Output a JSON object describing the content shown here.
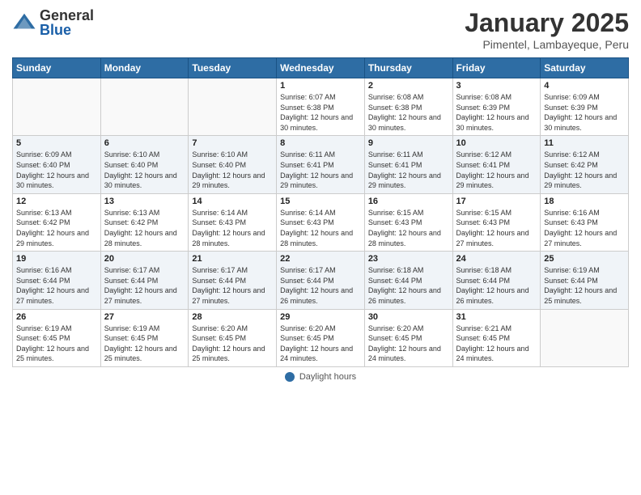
{
  "header": {
    "logo_general": "General",
    "logo_blue": "Blue",
    "title": "January 2025",
    "subtitle": "Pimentel, Lambayeque, Peru"
  },
  "days_of_week": [
    "Sunday",
    "Monday",
    "Tuesday",
    "Wednesday",
    "Thursday",
    "Friday",
    "Saturday"
  ],
  "weeks": [
    [
      {
        "day": "",
        "info": ""
      },
      {
        "day": "",
        "info": ""
      },
      {
        "day": "",
        "info": ""
      },
      {
        "day": "1",
        "info": "Sunrise: 6:07 AM\nSunset: 6:38 PM\nDaylight: 12 hours and 30 minutes."
      },
      {
        "day": "2",
        "info": "Sunrise: 6:08 AM\nSunset: 6:38 PM\nDaylight: 12 hours and 30 minutes."
      },
      {
        "day": "3",
        "info": "Sunrise: 6:08 AM\nSunset: 6:39 PM\nDaylight: 12 hours and 30 minutes."
      },
      {
        "day": "4",
        "info": "Sunrise: 6:09 AM\nSunset: 6:39 PM\nDaylight: 12 hours and 30 minutes."
      }
    ],
    [
      {
        "day": "5",
        "info": "Sunrise: 6:09 AM\nSunset: 6:40 PM\nDaylight: 12 hours and 30 minutes."
      },
      {
        "day": "6",
        "info": "Sunrise: 6:10 AM\nSunset: 6:40 PM\nDaylight: 12 hours and 30 minutes."
      },
      {
        "day": "7",
        "info": "Sunrise: 6:10 AM\nSunset: 6:40 PM\nDaylight: 12 hours and 29 minutes."
      },
      {
        "day": "8",
        "info": "Sunrise: 6:11 AM\nSunset: 6:41 PM\nDaylight: 12 hours and 29 minutes."
      },
      {
        "day": "9",
        "info": "Sunrise: 6:11 AM\nSunset: 6:41 PM\nDaylight: 12 hours and 29 minutes."
      },
      {
        "day": "10",
        "info": "Sunrise: 6:12 AM\nSunset: 6:41 PM\nDaylight: 12 hours and 29 minutes."
      },
      {
        "day": "11",
        "info": "Sunrise: 6:12 AM\nSunset: 6:42 PM\nDaylight: 12 hours and 29 minutes."
      }
    ],
    [
      {
        "day": "12",
        "info": "Sunrise: 6:13 AM\nSunset: 6:42 PM\nDaylight: 12 hours and 29 minutes."
      },
      {
        "day": "13",
        "info": "Sunrise: 6:13 AM\nSunset: 6:42 PM\nDaylight: 12 hours and 28 minutes."
      },
      {
        "day": "14",
        "info": "Sunrise: 6:14 AM\nSunset: 6:43 PM\nDaylight: 12 hours and 28 minutes."
      },
      {
        "day": "15",
        "info": "Sunrise: 6:14 AM\nSunset: 6:43 PM\nDaylight: 12 hours and 28 minutes."
      },
      {
        "day": "16",
        "info": "Sunrise: 6:15 AM\nSunset: 6:43 PM\nDaylight: 12 hours and 28 minutes."
      },
      {
        "day": "17",
        "info": "Sunrise: 6:15 AM\nSunset: 6:43 PM\nDaylight: 12 hours and 27 minutes."
      },
      {
        "day": "18",
        "info": "Sunrise: 6:16 AM\nSunset: 6:43 PM\nDaylight: 12 hours and 27 minutes."
      }
    ],
    [
      {
        "day": "19",
        "info": "Sunrise: 6:16 AM\nSunset: 6:44 PM\nDaylight: 12 hours and 27 minutes."
      },
      {
        "day": "20",
        "info": "Sunrise: 6:17 AM\nSunset: 6:44 PM\nDaylight: 12 hours and 27 minutes."
      },
      {
        "day": "21",
        "info": "Sunrise: 6:17 AM\nSunset: 6:44 PM\nDaylight: 12 hours and 27 minutes."
      },
      {
        "day": "22",
        "info": "Sunrise: 6:17 AM\nSunset: 6:44 PM\nDaylight: 12 hours and 26 minutes."
      },
      {
        "day": "23",
        "info": "Sunrise: 6:18 AM\nSunset: 6:44 PM\nDaylight: 12 hours and 26 minutes."
      },
      {
        "day": "24",
        "info": "Sunrise: 6:18 AM\nSunset: 6:44 PM\nDaylight: 12 hours and 26 minutes."
      },
      {
        "day": "25",
        "info": "Sunrise: 6:19 AM\nSunset: 6:44 PM\nDaylight: 12 hours and 25 minutes."
      }
    ],
    [
      {
        "day": "26",
        "info": "Sunrise: 6:19 AM\nSunset: 6:45 PM\nDaylight: 12 hours and 25 minutes."
      },
      {
        "day": "27",
        "info": "Sunrise: 6:19 AM\nSunset: 6:45 PM\nDaylight: 12 hours and 25 minutes."
      },
      {
        "day": "28",
        "info": "Sunrise: 6:20 AM\nSunset: 6:45 PM\nDaylight: 12 hours and 25 minutes."
      },
      {
        "day": "29",
        "info": "Sunrise: 6:20 AM\nSunset: 6:45 PM\nDaylight: 12 hours and 24 minutes."
      },
      {
        "day": "30",
        "info": "Sunrise: 6:20 AM\nSunset: 6:45 PM\nDaylight: 12 hours and 24 minutes."
      },
      {
        "day": "31",
        "info": "Sunrise: 6:21 AM\nSunset: 6:45 PM\nDaylight: 12 hours and 24 minutes."
      },
      {
        "day": "",
        "info": ""
      }
    ]
  ],
  "footer": {
    "label": "Daylight hours"
  }
}
